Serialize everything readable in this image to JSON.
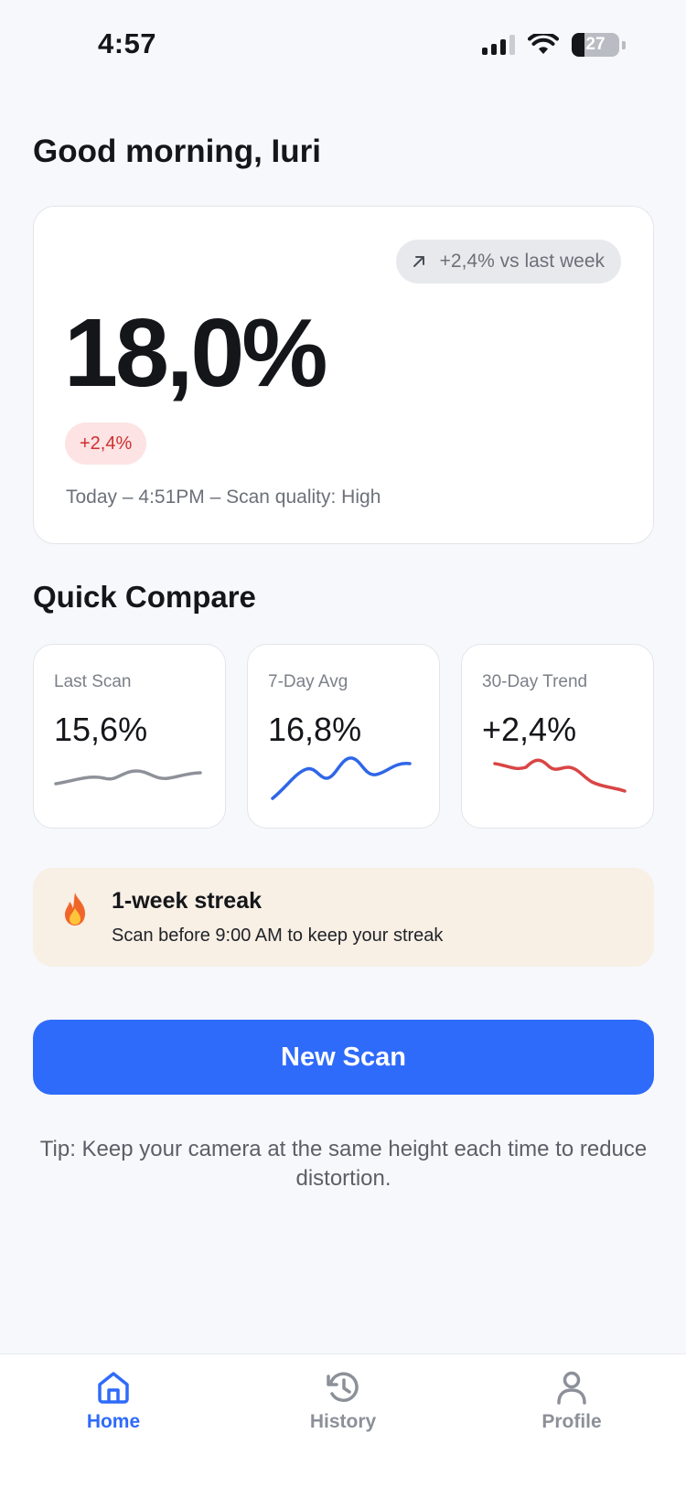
{
  "status_bar": {
    "time": "4:57",
    "battery_level": "27"
  },
  "greeting": "Good morning, Iuri",
  "hero": {
    "trend_text": "+2,4% vs last week",
    "value": "18,0%",
    "delta": "+2,4%",
    "meta": "Today – 4:51PM – Scan quality: High"
  },
  "quick_compare": {
    "title": "Quick Compare",
    "cards": [
      {
        "label": "Last Scan",
        "value": "15,6%",
        "color": "#8e9199"
      },
      {
        "label": "7-Day Avg",
        "value": "16,8%",
        "color": "#2f66e8"
      },
      {
        "label": "30-Day Trend",
        "value": "+2,4%",
        "color": "#d94545"
      }
    ]
  },
  "streak": {
    "title": "1-week streak",
    "subtitle": "Scan before 9:00 AM to keep your streak"
  },
  "new_scan_label": "New Scan",
  "tip": "Tip: Keep your camera at the same height each time to reduce distortion.",
  "tabs": [
    {
      "label": "Home",
      "icon": "home-icon",
      "active": true
    },
    {
      "label": "History",
      "icon": "history-icon",
      "active": false
    },
    {
      "label": "Profile",
      "icon": "profile-icon",
      "active": false
    }
  ],
  "colors": {
    "accent": "#2f6bfa",
    "negative": "#cf2f2f",
    "streak_bg": "#f8efe5"
  }
}
